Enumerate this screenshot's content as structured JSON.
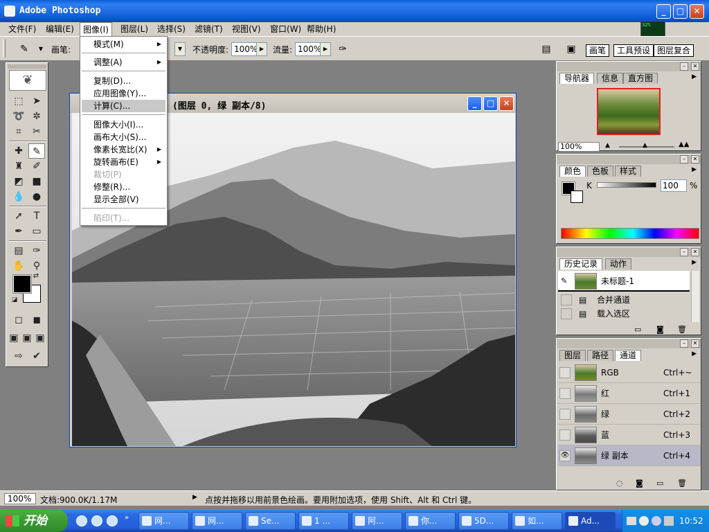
{
  "window": {
    "title": "Adobe Photoshop"
  },
  "menubar": {
    "items": [
      "文件(F)",
      "编辑(E)",
      "图像(I)",
      "图层(L)",
      "选择(S)",
      "滤镜(T)",
      "视图(V)",
      "窗口(W)",
      "帮助(H)"
    ]
  },
  "mini_monitor": {
    "text": "32%"
  },
  "options": {
    "brush_label": "画笔:",
    "opacity_label": "不透明度:",
    "opacity_value": "100%",
    "flow_label": "流量:",
    "flow_value": "100%",
    "well_tabs": [
      "画笔",
      "工具预设",
      "图层复合"
    ]
  },
  "image_menu": {
    "items": [
      {
        "label": "模式(M)",
        "submenu": true
      },
      {
        "label": "调整(A)",
        "submenu": true
      },
      {
        "label": "复制(D)..."
      },
      {
        "label": "应用图像(Y)..."
      },
      {
        "label": "计算(C)...",
        "highlighted": true
      },
      {
        "label": "图像大小(I)..."
      },
      {
        "label": "画布大小(S)..."
      },
      {
        "label": "像素长宽比(X)",
        "submenu": true
      },
      {
        "label": "旋转画布(E)",
        "submenu": true
      },
      {
        "label": "裁切(P)",
        "disabled": true
      },
      {
        "label": "修整(R)..."
      },
      {
        "label": "显示全部(V)"
      },
      {
        "label": "陷印(T)...",
        "disabled": true
      }
    ]
  },
  "document": {
    "title": "(图层 0, 绿 副本/8)"
  },
  "navigator": {
    "tabs": [
      "导航器",
      "信息",
      "直方图"
    ],
    "zoom": "100%"
  },
  "color": {
    "tabs": [
      "颜色",
      "色板",
      "样式"
    ],
    "channel": "K",
    "value": "100",
    "unit": "%"
  },
  "history": {
    "tabs": [
      "历史记录",
      "动作"
    ],
    "snapshot": "未标题-1",
    "steps": [
      "合并通道",
      "载入选区"
    ]
  },
  "channels": {
    "tabs": [
      "图层",
      "路径",
      "通道"
    ],
    "rows": [
      {
        "name": "RGB",
        "shortcut": "Ctrl+~"
      },
      {
        "name": "红",
        "shortcut": "Ctrl+1"
      },
      {
        "name": "绿",
        "shortcut": "Ctrl+2"
      },
      {
        "name": "蓝",
        "shortcut": "Ctrl+3"
      },
      {
        "name": "绿 副本",
        "shortcut": "Ctrl+4"
      }
    ]
  },
  "status": {
    "zoom": "100%",
    "doc": "文档:900.0K/1.17M",
    "hint": "点按并拖移以用前景色绘画。要用附加选项，使用 Shift、Alt 和 Ctrl 键。"
  },
  "taskbar": {
    "start_label": "开始",
    "buttons": [
      "网...",
      "网...",
      "Se...",
      "1 ...",
      "阿...",
      "你...",
      "5D...",
      "如...",
      "Ad..."
    ],
    "clock": "10:52"
  }
}
